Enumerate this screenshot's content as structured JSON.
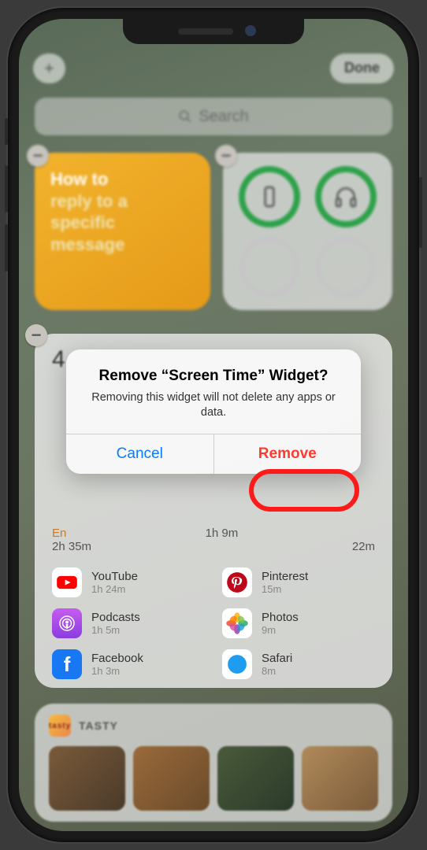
{
  "toolbar": {
    "add": "+",
    "done": "Done"
  },
  "search": {
    "placeholder": "Search"
  },
  "notes_widget": {
    "line1": "How to",
    "line2": "reply to a",
    "line3": "specific",
    "line4": "message"
  },
  "screen_time": {
    "hour_label": "4",
    "left_label": "En",
    "usage": {
      "left": "2h 35m",
      "mid": "1h 9m",
      "right": "22m"
    },
    "apps": [
      {
        "name": "YouTube",
        "time": "1h 24m",
        "icon": "youtube-icon",
        "color": "#ff0000"
      },
      {
        "name": "Pinterest",
        "time": "15m",
        "icon": "pinterest-icon",
        "color": "#bd081c"
      },
      {
        "name": "Podcasts",
        "time": "1h 5m",
        "icon": "podcasts-icon",
        "color": "#9a44e0"
      },
      {
        "name": "Photos",
        "time": "9m",
        "icon": "photos-icon",
        "color": "#ffffff"
      },
      {
        "name": "Facebook",
        "time": "1h 3m",
        "icon": "facebook-icon",
        "color": "#1877f2"
      },
      {
        "name": "Safari",
        "time": "8m",
        "icon": "safari-icon",
        "color": "#ffffff"
      }
    ]
  },
  "tasty": {
    "label": "TASTY"
  },
  "alert": {
    "title": "Remove “Screen Time” Widget?",
    "message": "Removing this widget will not delete any apps or data.",
    "cancel": "Cancel",
    "remove": "Remove"
  }
}
